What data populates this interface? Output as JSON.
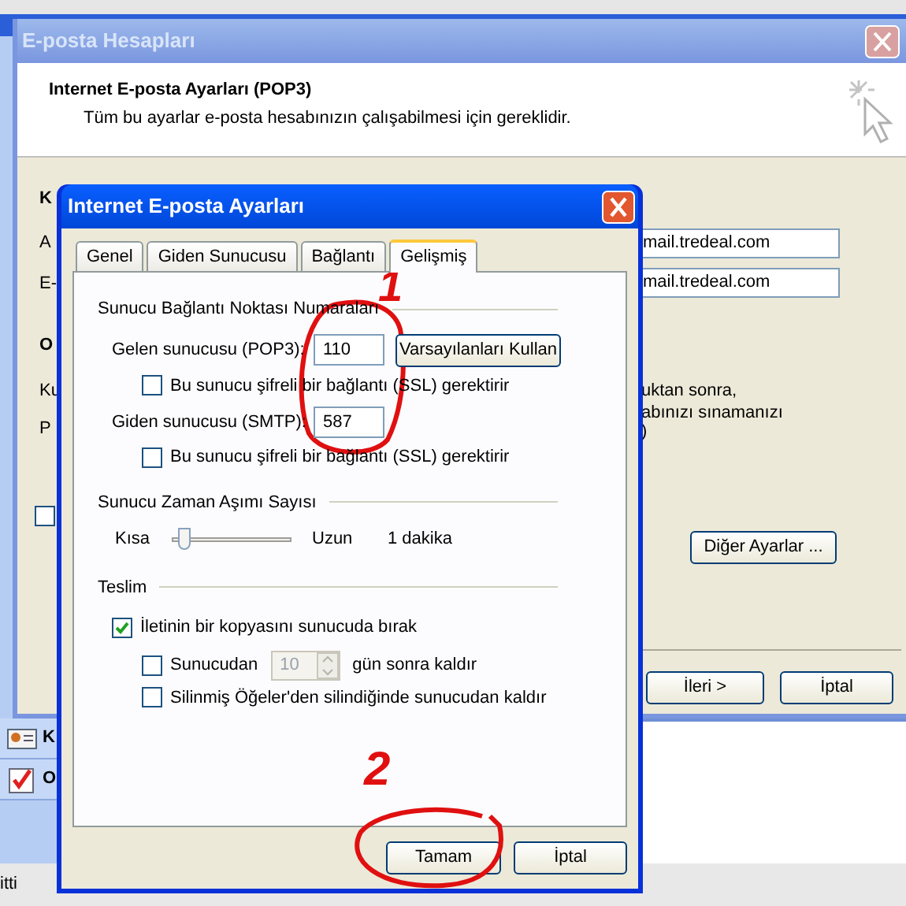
{
  "outlook": {
    "status": "itti",
    "nav_items": [
      {
        "label": "K"
      },
      {
        "label": "O"
      }
    ]
  },
  "accounts_window": {
    "title": "E-posta Hesapları",
    "heading": "Internet E-posta Ayarları (POP3)",
    "subheading": "Tüm bu ayarlar e-posta hesabınızın çalışabilmesi için gereklidir.",
    "left_fragments": [
      {
        "text": "K",
        "kind": "heading"
      },
      {
        "text": "A",
        "kind": "label"
      },
      {
        "text": "E-",
        "kind": "label"
      },
      {
        "text": "O",
        "kind": "heading"
      },
      {
        "text": "Ku",
        "kind": "label"
      },
      {
        "text": "P",
        "kind": "label"
      }
    ],
    "server_fields": [
      "mail.tredeal.com",
      "mail.tredeal.com"
    ],
    "note_fragments": [
      "uktan sonra,",
      "abınızı sınamanızı",
      ")"
    ],
    "checkbox": {
      "checked": false
    },
    "more_button": "Diğer Ayarlar ...",
    "buttons": [
      "İleri >",
      "İptal"
    ]
  },
  "dialog": {
    "title": "Internet E-posta Ayarları",
    "tabs": [
      {
        "label": "Genel",
        "selected": false
      },
      {
        "label": "Giden Sunucusu",
        "selected": false
      },
      {
        "label": "Bağlantı",
        "selected": false
      },
      {
        "label": "Gelişmiş",
        "selected": true
      }
    ],
    "ports_group": "Sunucu Bağlantı Noktası Numaraları",
    "incoming": {
      "label": "Gelen sunucusu (POP3):",
      "value": "110",
      "ssl": {
        "label": "Bu sunucu şifreli bir bağlantı (SSL) gerektirir",
        "checked": false
      }
    },
    "defaults_button": "Varsayılanları Kullan",
    "outgoing": {
      "label": "Giden sunucusu (SMTP):",
      "value": "587",
      "ssl": {
        "label": "Bu sunucu şifreli bir bağlantı (SSL) gerektirir",
        "checked": false
      }
    },
    "timeout_group": "Sunucu Zaman Aşımı Sayısı",
    "timeout": {
      "min_label": "Kısa",
      "max_label": "Uzun",
      "level": 0.06,
      "reading": "1 dakika"
    },
    "delivery_group": "Teslim",
    "leave_copy": {
      "label": "İletinin bir kopyasını sunucuda bırak",
      "checked": true
    },
    "remove_after": {
      "label": "Sunucudan",
      "checked": false,
      "days": "10",
      "days_disabled": true,
      "suffix": "gün sonra kaldır"
    },
    "remove_deleted": {
      "label": "Silinmiş Öğeler'den silindiğinde sunucudan kaldır",
      "checked": false
    },
    "buttons": [
      "Tamam",
      "İptal"
    ]
  },
  "annotations": [
    {
      "label": "1"
    },
    {
      "label": "2"
    }
  ]
}
